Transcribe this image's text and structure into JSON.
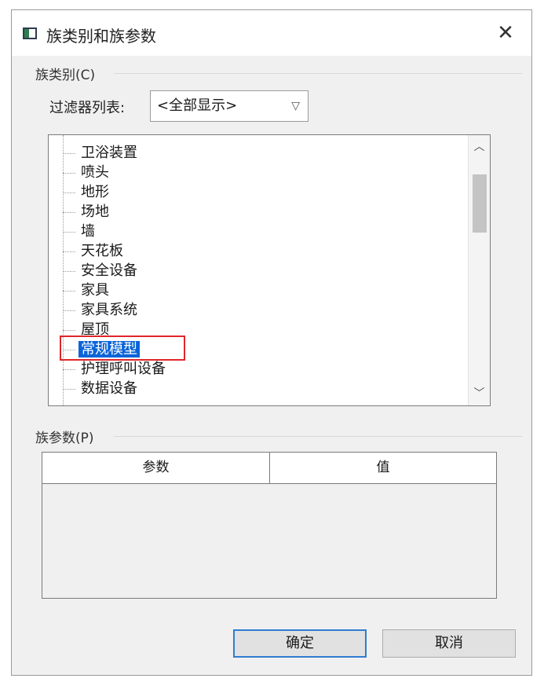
{
  "dialog": {
    "title": "族类别和族参数",
    "close_symbol": "✕"
  },
  "category_group": {
    "label": "族类别(C)"
  },
  "filter": {
    "label": "过滤器列表:",
    "value": "<全部显示>"
  },
  "tree": {
    "items": [
      {
        "label": "卫浴装置",
        "selected": false
      },
      {
        "label": "喷头",
        "selected": false
      },
      {
        "label": "地形",
        "selected": false
      },
      {
        "label": "场地",
        "selected": false
      },
      {
        "label": "墙",
        "selected": false
      },
      {
        "label": "天花板",
        "selected": false
      },
      {
        "label": "安全设备",
        "selected": false
      },
      {
        "label": "家具",
        "selected": false
      },
      {
        "label": "家具系统",
        "selected": false
      },
      {
        "label": "屋顶",
        "selected": false
      },
      {
        "label": "常规模型",
        "selected": true
      },
      {
        "label": "护理呼叫设备",
        "selected": false
      },
      {
        "label": "数据设备",
        "selected": false
      }
    ],
    "highlight_color": "#e0262b",
    "selection_color": "#0a64d8"
  },
  "params_group": {
    "label": "族参数(P)"
  },
  "params_table": {
    "columns": [
      "参数",
      "值"
    ]
  },
  "buttons": {
    "ok": "确定",
    "cancel": "取消"
  }
}
